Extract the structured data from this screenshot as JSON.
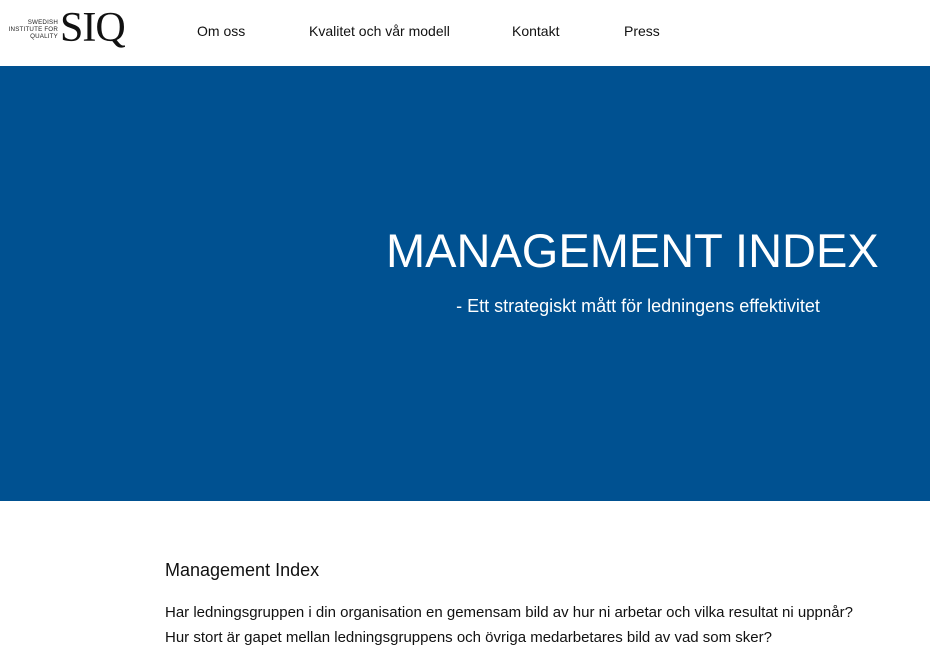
{
  "logo": {
    "small_lines": [
      "SWEDISH",
      "INSTITUTE FOR",
      "QUALITY"
    ],
    "big": "SIQ"
  },
  "nav": {
    "items": [
      {
        "label": "Om oss"
      },
      {
        "label": "Kvalitet och vår modell"
      },
      {
        "label": "Kontakt"
      },
      {
        "label": "Press"
      }
    ]
  },
  "hero": {
    "title": "MANAGEMENT INDEX",
    "subtitle": "- Ett strategiskt mått för ledningens effektivitet",
    "background_color": "#005191"
  },
  "content": {
    "heading": "Management Index",
    "paragraph": "Har ledningsgruppen i din organisation en gemensam bild av hur ni arbetar och vilka resultat ni uppnår? Hur stort är gapet mellan ledningsgruppens och övriga medarbetares bild av vad som sker?"
  }
}
